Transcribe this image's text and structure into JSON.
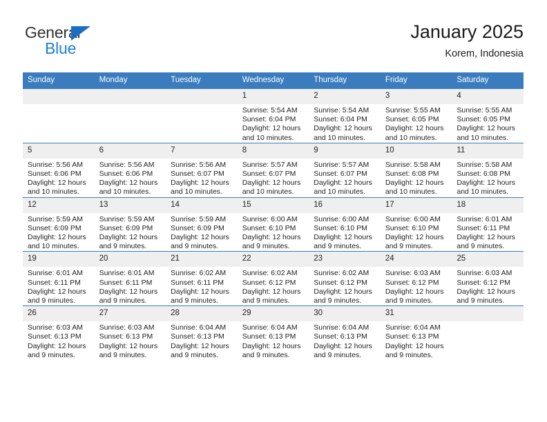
{
  "brand": {
    "name_part1": "General",
    "name_part2": "Blue",
    "colors": {
      "general_text": "#303030",
      "blue_text": "#1b7fd4",
      "triangle": "#1b6ec2"
    }
  },
  "header": {
    "title": "January 2025",
    "subtitle": "Korem, Indonesia"
  },
  "theme": {
    "header_row_bg": "#3a7cbd",
    "header_row_text": "#ffffff",
    "daynum_strip_bg": "#efefef",
    "row_divider": "#3a7cbd",
    "cell_bg": "#ffffff"
  },
  "calendar": {
    "weekday_headers": [
      "Sunday",
      "Monday",
      "Tuesday",
      "Wednesday",
      "Thursday",
      "Friday",
      "Saturday"
    ],
    "labels": {
      "sunrise_prefix": "Sunrise:",
      "sunset_prefix": "Sunset:",
      "daylight_prefix": "Daylight:"
    },
    "weeks": [
      [
        {
          "day": "",
          "empty": true
        },
        {
          "day": "",
          "empty": true
        },
        {
          "day": "",
          "empty": true
        },
        {
          "day": "1",
          "sunrise": "Sunrise: 5:54 AM",
          "sunset": "Sunset: 6:04 PM",
          "daylight_l1": "Daylight: 12 hours",
          "daylight_l2": "and 10 minutes."
        },
        {
          "day": "2",
          "sunrise": "Sunrise: 5:54 AM",
          "sunset": "Sunset: 6:04 PM",
          "daylight_l1": "Daylight: 12 hours",
          "daylight_l2": "and 10 minutes."
        },
        {
          "day": "3",
          "sunrise": "Sunrise: 5:55 AM",
          "sunset": "Sunset: 6:05 PM",
          "daylight_l1": "Daylight: 12 hours",
          "daylight_l2": "and 10 minutes."
        },
        {
          "day": "4",
          "sunrise": "Sunrise: 5:55 AM",
          "sunset": "Sunset: 6:05 PM",
          "daylight_l1": "Daylight: 12 hours",
          "daylight_l2": "and 10 minutes."
        }
      ],
      [
        {
          "day": "5",
          "sunrise": "Sunrise: 5:56 AM",
          "sunset": "Sunset: 6:06 PM",
          "daylight_l1": "Daylight: 12 hours",
          "daylight_l2": "and 10 minutes."
        },
        {
          "day": "6",
          "sunrise": "Sunrise: 5:56 AM",
          "sunset": "Sunset: 6:06 PM",
          "daylight_l1": "Daylight: 12 hours",
          "daylight_l2": "and 10 minutes."
        },
        {
          "day": "7",
          "sunrise": "Sunrise: 5:56 AM",
          "sunset": "Sunset: 6:07 PM",
          "daylight_l1": "Daylight: 12 hours",
          "daylight_l2": "and 10 minutes."
        },
        {
          "day": "8",
          "sunrise": "Sunrise: 5:57 AM",
          "sunset": "Sunset: 6:07 PM",
          "daylight_l1": "Daylight: 12 hours",
          "daylight_l2": "and 10 minutes."
        },
        {
          "day": "9",
          "sunrise": "Sunrise: 5:57 AM",
          "sunset": "Sunset: 6:07 PM",
          "daylight_l1": "Daylight: 12 hours",
          "daylight_l2": "and 10 minutes."
        },
        {
          "day": "10",
          "sunrise": "Sunrise: 5:58 AM",
          "sunset": "Sunset: 6:08 PM",
          "daylight_l1": "Daylight: 12 hours",
          "daylight_l2": "and 10 minutes."
        },
        {
          "day": "11",
          "sunrise": "Sunrise: 5:58 AM",
          "sunset": "Sunset: 6:08 PM",
          "daylight_l1": "Daylight: 12 hours",
          "daylight_l2": "and 10 minutes."
        }
      ],
      [
        {
          "day": "12",
          "sunrise": "Sunrise: 5:59 AM",
          "sunset": "Sunset: 6:09 PM",
          "daylight_l1": "Daylight: 12 hours",
          "daylight_l2": "and 10 minutes."
        },
        {
          "day": "13",
          "sunrise": "Sunrise: 5:59 AM",
          "sunset": "Sunset: 6:09 PM",
          "daylight_l1": "Daylight: 12 hours",
          "daylight_l2": "and 9 minutes."
        },
        {
          "day": "14",
          "sunrise": "Sunrise: 5:59 AM",
          "sunset": "Sunset: 6:09 PM",
          "daylight_l1": "Daylight: 12 hours",
          "daylight_l2": "and 9 minutes."
        },
        {
          "day": "15",
          "sunrise": "Sunrise: 6:00 AM",
          "sunset": "Sunset: 6:10 PM",
          "daylight_l1": "Daylight: 12 hours",
          "daylight_l2": "and 9 minutes."
        },
        {
          "day": "16",
          "sunrise": "Sunrise: 6:00 AM",
          "sunset": "Sunset: 6:10 PM",
          "daylight_l1": "Daylight: 12 hours",
          "daylight_l2": "and 9 minutes."
        },
        {
          "day": "17",
          "sunrise": "Sunrise: 6:00 AM",
          "sunset": "Sunset: 6:10 PM",
          "daylight_l1": "Daylight: 12 hours",
          "daylight_l2": "and 9 minutes."
        },
        {
          "day": "18",
          "sunrise": "Sunrise: 6:01 AM",
          "sunset": "Sunset: 6:11 PM",
          "daylight_l1": "Daylight: 12 hours",
          "daylight_l2": "and 9 minutes."
        }
      ],
      [
        {
          "day": "19",
          "sunrise": "Sunrise: 6:01 AM",
          "sunset": "Sunset: 6:11 PM",
          "daylight_l1": "Daylight: 12 hours",
          "daylight_l2": "and 9 minutes."
        },
        {
          "day": "20",
          "sunrise": "Sunrise: 6:01 AM",
          "sunset": "Sunset: 6:11 PM",
          "daylight_l1": "Daylight: 12 hours",
          "daylight_l2": "and 9 minutes."
        },
        {
          "day": "21",
          "sunrise": "Sunrise: 6:02 AM",
          "sunset": "Sunset: 6:11 PM",
          "daylight_l1": "Daylight: 12 hours",
          "daylight_l2": "and 9 minutes."
        },
        {
          "day": "22",
          "sunrise": "Sunrise: 6:02 AM",
          "sunset": "Sunset: 6:12 PM",
          "daylight_l1": "Daylight: 12 hours",
          "daylight_l2": "and 9 minutes."
        },
        {
          "day": "23",
          "sunrise": "Sunrise: 6:02 AM",
          "sunset": "Sunset: 6:12 PM",
          "daylight_l1": "Daylight: 12 hours",
          "daylight_l2": "and 9 minutes."
        },
        {
          "day": "24",
          "sunrise": "Sunrise: 6:03 AM",
          "sunset": "Sunset: 6:12 PM",
          "daylight_l1": "Daylight: 12 hours",
          "daylight_l2": "and 9 minutes."
        },
        {
          "day": "25",
          "sunrise": "Sunrise: 6:03 AM",
          "sunset": "Sunset: 6:12 PM",
          "daylight_l1": "Daylight: 12 hours",
          "daylight_l2": "and 9 minutes."
        }
      ],
      [
        {
          "day": "26",
          "sunrise": "Sunrise: 6:03 AM",
          "sunset": "Sunset: 6:13 PM",
          "daylight_l1": "Daylight: 12 hours",
          "daylight_l2": "and 9 minutes."
        },
        {
          "day": "27",
          "sunrise": "Sunrise: 6:03 AM",
          "sunset": "Sunset: 6:13 PM",
          "daylight_l1": "Daylight: 12 hours",
          "daylight_l2": "and 9 minutes."
        },
        {
          "day": "28",
          "sunrise": "Sunrise: 6:04 AM",
          "sunset": "Sunset: 6:13 PM",
          "daylight_l1": "Daylight: 12 hours",
          "daylight_l2": "and 9 minutes."
        },
        {
          "day": "29",
          "sunrise": "Sunrise: 6:04 AM",
          "sunset": "Sunset: 6:13 PM",
          "daylight_l1": "Daylight: 12 hours",
          "daylight_l2": "and 9 minutes."
        },
        {
          "day": "30",
          "sunrise": "Sunrise: 6:04 AM",
          "sunset": "Sunset: 6:13 PM",
          "daylight_l1": "Daylight: 12 hours",
          "daylight_l2": "and 9 minutes."
        },
        {
          "day": "31",
          "sunrise": "Sunrise: 6:04 AM",
          "sunset": "Sunset: 6:13 PM",
          "daylight_l1": "Daylight: 12 hours",
          "daylight_l2": "and 9 minutes."
        },
        {
          "day": "",
          "empty": true
        }
      ]
    ]
  }
}
